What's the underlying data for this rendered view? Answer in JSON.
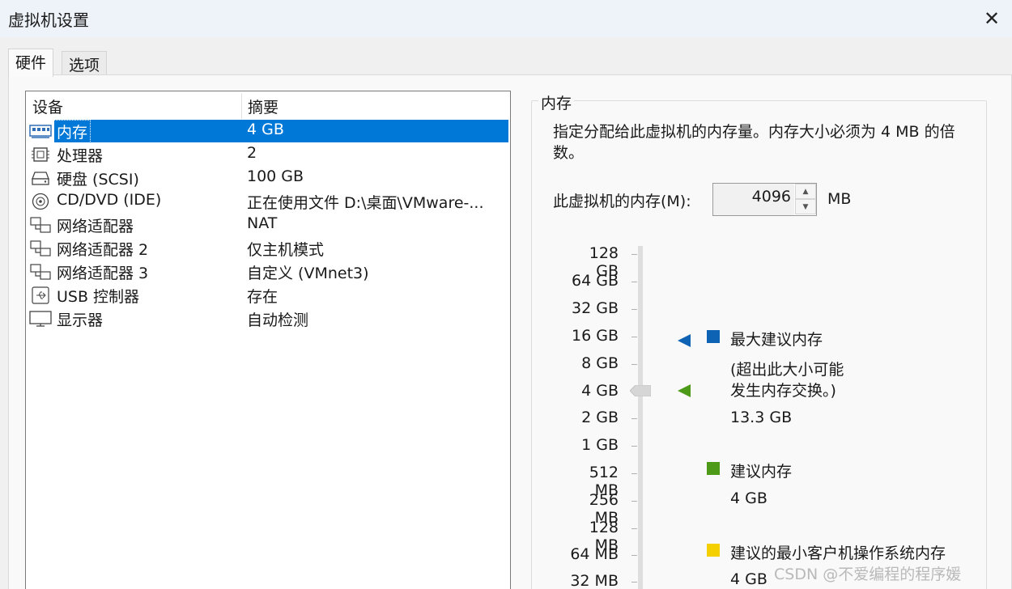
{
  "window": {
    "title": "虚拟机设置",
    "close_glyph": "✕"
  },
  "tabs": [
    {
      "label": "硬件",
      "active": true
    },
    {
      "label": "选项",
      "active": false
    }
  ],
  "device_table": {
    "columns": [
      "设备",
      "摘要"
    ],
    "rows": [
      {
        "name": "内存",
        "summary": "4 GB",
        "icon": "memory-icon",
        "selected": true
      },
      {
        "name": "处理器",
        "summary": "2",
        "icon": "processor-icon"
      },
      {
        "name": "硬盘 (SCSI)",
        "summary": "100 GB",
        "icon": "hard-disk-icon"
      },
      {
        "name": "CD/DVD (IDE)",
        "summary": "正在使用文件 D:\\桌面\\VMware-...",
        "icon": "cd-dvd-icon"
      },
      {
        "name": "网络适配器",
        "summary": "NAT",
        "icon": "network-adapter-icon"
      },
      {
        "name": "网络适配器 2",
        "summary": "仅主机模式",
        "icon": "network-adapter-icon"
      },
      {
        "name": "网络适配器 3",
        "summary": "自定义 (VMnet3)",
        "icon": "network-adapter-icon"
      },
      {
        "name": "USB 控制器",
        "summary": "存在",
        "icon": "usb-icon"
      },
      {
        "name": "显示器",
        "summary": "自动检测",
        "icon": "monitor-icon"
      }
    ]
  },
  "memory": {
    "group_title": "内存",
    "description": "指定分配给此虚拟机的内存量。内存大小必须为 4 MB 的倍数。",
    "field_label": "此虚拟机的内存(M):",
    "value": "4096",
    "unit": "MB",
    "scale_ticks": [
      "128 GB",
      "64 GB",
      "32 GB",
      "16 GB",
      "8 GB",
      "4 GB",
      "2 GB",
      "1 GB",
      "512 MB",
      "256 MB",
      "128 MB",
      "64 MB",
      "32 MB"
    ],
    "current_level": "4 GB",
    "legend": {
      "max_recommended": {
        "title": "最大建议内存",
        "note_line1": "(超出此大小可能",
        "note_line2": "发生内存交换。)",
        "value": "13.3 GB",
        "color": "#0e63b4"
      },
      "recommended": {
        "title": "建议内存",
        "value": "4 GB",
        "color": "#4d9a19"
      },
      "min_guest": {
        "title": "建议的最小客户机操作系统内存",
        "value": "4 GB",
        "color": "#f5d000"
      }
    }
  },
  "watermark": "CSDN @不爱编程的程序媛",
  "colors": {
    "selection": "#0078d7",
    "titlebar": "#eef3fa"
  }
}
